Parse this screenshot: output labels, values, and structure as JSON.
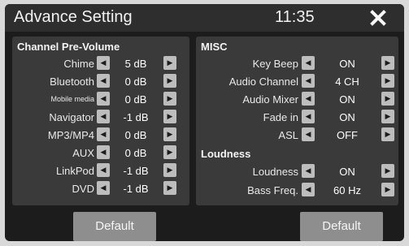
{
  "header": {
    "title": "Advance Setting",
    "time": "11:35"
  },
  "left_panel": {
    "title": "Channel Pre-Volume",
    "rows": [
      {
        "label": "Chime",
        "value": "5 dB"
      },
      {
        "label": "Bluetooth",
        "value": "0 dB"
      },
      {
        "label": "Mobile media",
        "value": "0 dB"
      },
      {
        "label": "Navigator",
        "value": "-1 dB"
      },
      {
        "label": "MP3/MP4",
        "value": "0 dB"
      },
      {
        "label": "AUX",
        "value": "0 dB"
      },
      {
        "label": "LinkPod",
        "value": "-1 dB"
      },
      {
        "label": "DVD",
        "value": "-1 dB"
      }
    ],
    "default_label": "Default"
  },
  "right_panel": {
    "misc_title": "MISC",
    "misc_rows": [
      {
        "label": "Key Beep",
        "value": "ON"
      },
      {
        "label": "Audio Channel",
        "value": "4 CH"
      },
      {
        "label": "Audio Mixer",
        "value": "ON"
      },
      {
        "label": "Fade in",
        "value": "ON"
      },
      {
        "label": "ASL",
        "value": "OFF"
      }
    ],
    "loudness_title": "Loudness",
    "loudness_rows": [
      {
        "label": "Loudness",
        "value": "ON"
      },
      {
        "label": "Bass Freq.",
        "value": "60 Hz"
      }
    ],
    "default_label": "Default"
  },
  "icons": {
    "close": "close-icon",
    "decrease": "left-arrow-icon",
    "increase": "right-arrow-icon"
  },
  "colors": {
    "screen_bg": "#1c1c1c",
    "panel_bg": "#3a3a3a",
    "button_bg": "#bdbdbd",
    "default_bg": "#8e8e8e"
  }
}
